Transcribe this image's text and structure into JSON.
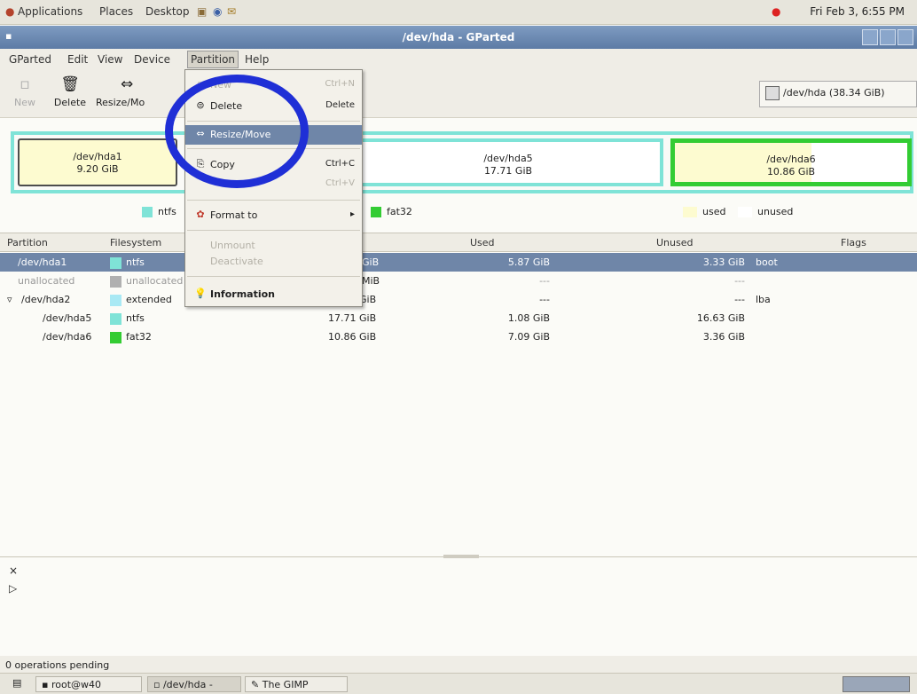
{
  "top_panel": {
    "applications": "Applications",
    "places": "Places",
    "desktop": "Desktop",
    "clock": "Fri Feb 3, 6:55 PM"
  },
  "window": {
    "title": "/dev/hda - GParted"
  },
  "menubar": {
    "items": [
      "GParted",
      "Edit",
      "View",
      "Device",
      "Partition",
      "Help"
    ]
  },
  "toolbar": {
    "new": "New",
    "delete": "Delete",
    "resize": "Resize/Mo",
    "device_selector": "/dev/hda  (38.34 GiB)"
  },
  "partition_map": [
    {
      "name": "/dev/hda1",
      "size": "9.20 GiB"
    },
    {
      "name": "/dev/hda5",
      "size": "17.71 GiB"
    },
    {
      "name": "/dev/hda6",
      "size": "10.86 GiB"
    }
  ],
  "legend": {
    "ntfs": "ntfs",
    "fat32": "fat32",
    "used": "used",
    "unused": "unused"
  },
  "table": {
    "headers": [
      "Partition",
      "Filesystem",
      "Used",
      "Unused",
      "Flags"
    ],
    "rows": [
      {
        "partition": "/dev/hda1",
        "filesystem": "ntfs",
        "size": "GiB",
        "used": "5.87 GiB",
        "unused": "3.33 GiB",
        "flags": "boot"
      },
      {
        "partition": "unallocated",
        "filesystem": "unallocated",
        "size": "MiB",
        "used": "---",
        "unused": "---",
        "flags": ""
      },
      {
        "partition": "/dev/hda2",
        "filesystem": "extended",
        "size": "28.57 GiB",
        "used": "---",
        "unused": "---",
        "flags": "lba"
      },
      {
        "partition": "/dev/hda5",
        "filesystem": "ntfs",
        "size": "17.71 GiB",
        "used": "1.08 GiB",
        "unused": "16.63 GiB",
        "flags": ""
      },
      {
        "partition": "/dev/hda6",
        "filesystem": "fat32",
        "size": "10.86 GiB",
        "used": "7.09 GiB",
        "unused": "3.36 GiB",
        "flags": ""
      }
    ]
  },
  "partition_menu": {
    "new": "New",
    "new_acc": "Ctrl+N",
    "delete": "Delete",
    "delete_acc": "Delete",
    "resize": "Resize/Move",
    "copy": "Copy",
    "copy_acc": "Ctrl+C",
    "paste_acc": "Ctrl+V",
    "format": "Format to",
    "unmount": "Unmount",
    "deactivate": "Deactivate",
    "information": "Information"
  },
  "status": "0 operations pending",
  "taskbar": {
    "terminal": "root@w40",
    "gparted": "/dev/hda -",
    "gimp": "The GIMP"
  },
  "colors": {
    "ntfs": "#7fe3d7",
    "fat32": "#33cc33",
    "used": "#fdfbd0",
    "selection": "#6f86a8",
    "circle": "#1f2fd6"
  }
}
